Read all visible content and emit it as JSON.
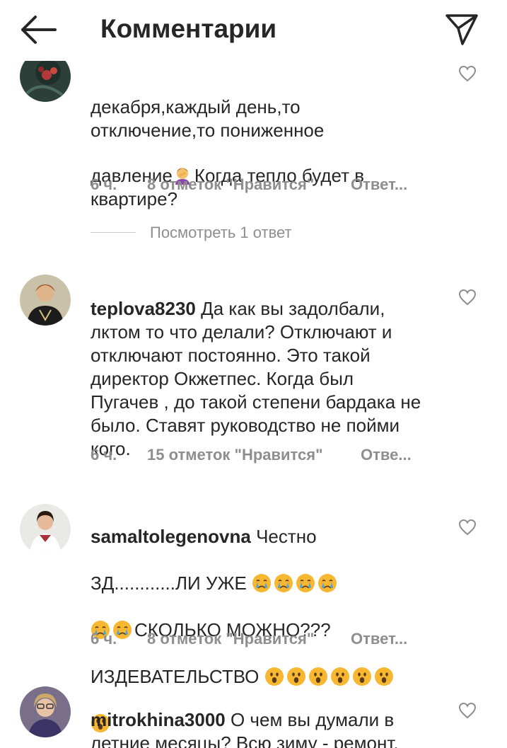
{
  "header": {
    "title": "Комментарии",
    "back_icon": "arrow-left-icon",
    "send_icon": "paper-plane-icon"
  },
  "comments": [
    {
      "username": "",
      "text": "декабря,каждый день,то\nотключение,то пониженное\nдавление",
      "text_after_emoji": "Когда тепло будет в\nквартире?",
      "time": "6 ч.",
      "likes": "8 отметок \"Нравится\"",
      "reply": "Ответ..."
    },
    {
      "username": "teplova8230",
      "text": "Да как вы задолбали, лктом то что делали? Отключают и отключают постоянно. Это такой директор Окжетпес. Когда был Пугачев , до такой степени бардака не было. Ставят руководство не пойми кого.",
      "time": "6 ч.",
      "likes": "15 отметок \"Нравится\"",
      "reply": "Отве..."
    },
    {
      "username": "samaltolegenovna",
      "text_line1": "Честно",
      "text_line2": "ЗД............ЛИ УЖЕ",
      "text_line3": "СКОЛЬКО МОЖНО???",
      "text_line4": "ИЗДЕВАТЕЛЬСТВО",
      "time": "6 ч.",
      "likes": "8 отметок \"Нравится\"",
      "reply": "Ответ..."
    },
    {
      "username": "mitrokhina3000",
      "text": "О чем вы думали в летние месяцы? Всю зиму - ремонт. Это просто ужас!!!!"
    }
  ],
  "view_replies": "Посмотреть 1 ответ",
  "colors": {
    "text": "#262626",
    "secondary": "#8e8e8e",
    "divider": "#c7c7c7"
  }
}
